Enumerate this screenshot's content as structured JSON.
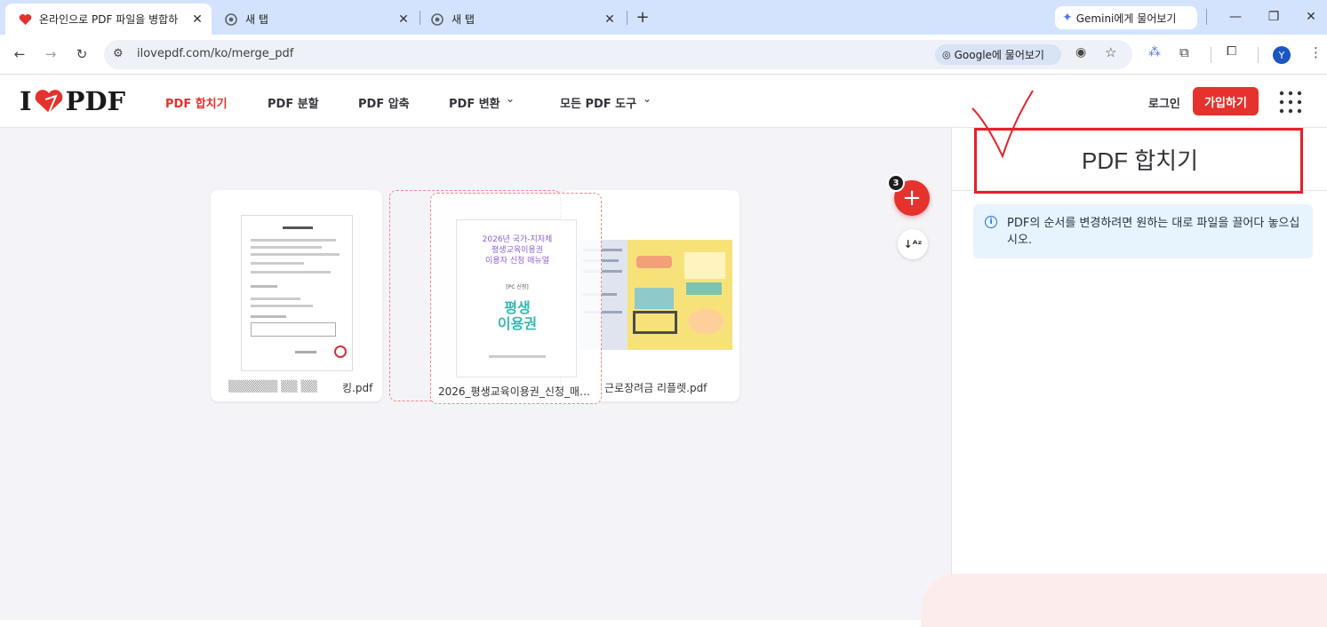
{
  "browser": {
    "tabs": [
      {
        "title": "온라인으로 PDF 파일을 병합하",
        "active": true
      },
      {
        "title": "새 탭",
        "active": false
      },
      {
        "title": "새 탭",
        "active": false
      }
    ],
    "gemini_label": "Gemini에게 물어보기",
    "url": "ilovepdf.com/ko/merge_pdf",
    "google_search_label": "Google에 물어보기",
    "profile_initial": "Y"
  },
  "site": {
    "logo_left": "I",
    "logo_right": "PDF",
    "nav": [
      {
        "label": "PDF 합치기",
        "active": true
      },
      {
        "label": "PDF 분할",
        "active": false
      },
      {
        "label": "PDF 압축",
        "active": false
      },
      {
        "label": "PDF 변환",
        "active": false
      },
      {
        "label": "모든 PDF 도구",
        "active": false
      }
    ],
    "login_label": "로그인",
    "signup_label": "가입하기",
    "accent": "#e5322d"
  },
  "workspace": {
    "file_count": "3",
    "files": [
      {
        "name": "킹.pdf"
      },
      {
        "name": "2026_평생교육이용권_신청_매…"
      },
      {
        "name": "근로장려금 리플렛.pdf"
      }
    ],
    "doc2_lines": [
      "2026년 국가-지자체",
      "평생교육이용권",
      "이용자 신청 매뉴얼"
    ],
    "doc2_sub": "[PC 신청]",
    "doc2_brand": "평생\n이용권"
  },
  "sidebar": {
    "title": "PDF 합치기",
    "info": "PDF의 순서를 변경하려면 원하는 대로 파일을 끌어다 놓으십시오."
  }
}
